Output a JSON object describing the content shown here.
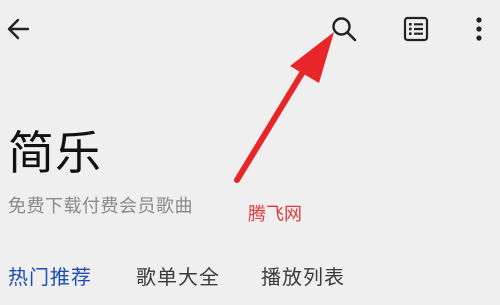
{
  "header": {
    "back_icon": "back-arrow-icon",
    "search_icon": "search-icon",
    "list_icon": "list-icon",
    "more_icon": "more-vertical-icon"
  },
  "app": {
    "title": "简乐",
    "subtitle": "免费下载付费会员歌曲"
  },
  "watermark": "腾飞网",
  "tabs": [
    {
      "label": "热门推荐",
      "active": true
    },
    {
      "label": "歌单大全",
      "active": false
    },
    {
      "label": "播放列表",
      "active": false
    }
  ],
  "colors": {
    "background": "#efefef",
    "active_tab": "#1e4db3",
    "annotation_arrow": "#e8262a",
    "watermark": "#e03a3a"
  }
}
